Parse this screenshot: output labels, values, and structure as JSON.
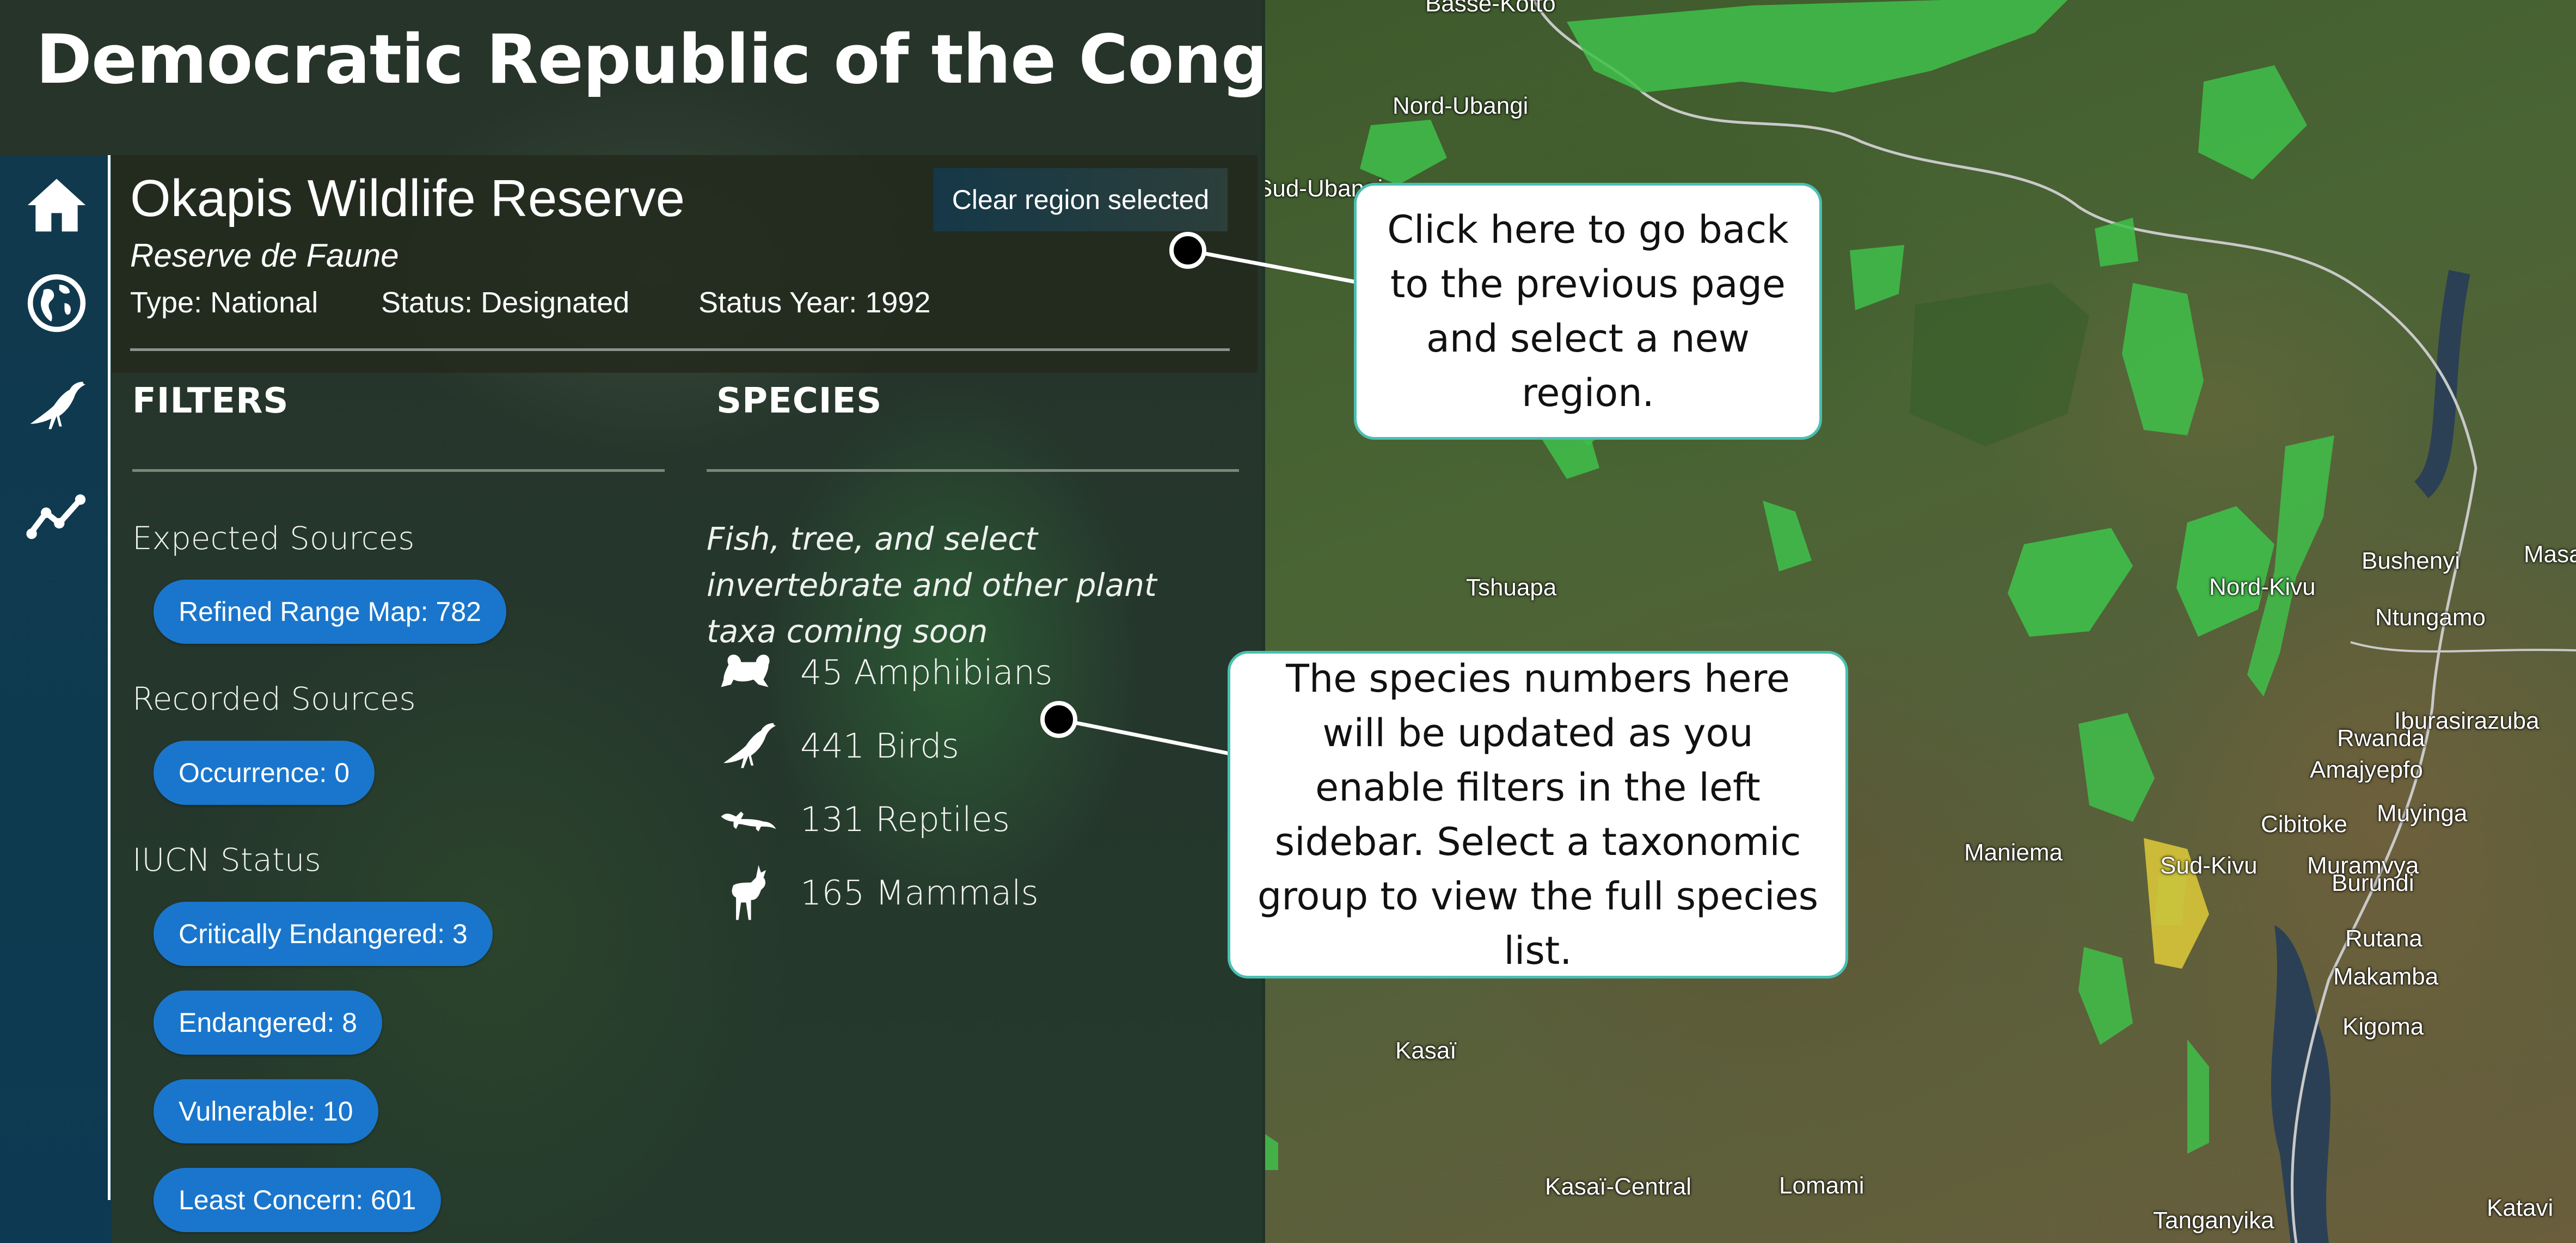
{
  "country_title": "Democratic Republic of the Congo",
  "nav": [
    {
      "name": "home-icon"
    },
    {
      "name": "globe-icon"
    },
    {
      "name": "bird-icon"
    },
    {
      "name": "trend-chart-icon"
    }
  ],
  "region": {
    "name": "Okapis Wildlife Reserve",
    "designation": "Reserve de Faune",
    "type": "Type: National",
    "status": "Status: Designated",
    "status_year": "Status Year: 1992",
    "clear_button": "Clear region selected"
  },
  "filters": {
    "title": "FILTERS",
    "expected_label": "Expected Sources",
    "expected": [
      "Refined Range Map: 782"
    ],
    "recorded_label": "Recorded Sources",
    "recorded": [
      "Occurrence: 0"
    ],
    "iucn_label": "IUCN Status",
    "iucn": [
      "Critically Endangered: 3",
      "Endangered: 8",
      "Vulnerable: 10",
      "Least Concern: 601"
    ]
  },
  "species": {
    "title": "SPECIES",
    "note": "Fish, tree, and select invertebrate and other plant taxa coming soon",
    "groups": [
      {
        "label": "45 Amphibians",
        "icon": "frog-icon"
      },
      {
        "label": "441 Birds",
        "icon": "bird-icon"
      },
      {
        "label": "131 Reptiles",
        "icon": "lizard-icon"
      },
      {
        "label": "165 Mammals",
        "icon": "antelope-icon"
      }
    ]
  },
  "callouts": {
    "back": "Click here to go back to the previous page and select a new region.",
    "species": "The species numbers here will be updated as you enable filters in the left sidebar. Select a taxonomic group to view the full species list."
  },
  "map_labels": [
    "Basse-Kotto",
    "Nord-Ubangi",
    "Sud-Ubangi",
    "Tshuapa",
    "Nord-Kivu",
    "Bushenyi",
    "Masaka",
    "Ntungamo",
    "Maniema",
    "Sud-Kivu",
    "Rwanda",
    "Amajyepfo",
    "Iburasirazuba",
    "Cibitoke",
    "Muyinga",
    "Muramvya",
    "Burundi",
    "Rutana",
    "Makamba",
    "Kigoma",
    "Kasaï",
    "Kasaï-Central",
    "Lomami",
    "Tanganyika",
    "Katavi"
  ],
  "colors": {
    "pill": "#1a76cc",
    "icon_rail": "#10394d",
    "callout_border": "#4bbfb4",
    "protected_area": "#3fbf4a",
    "highlight_area": "#d8c43a"
  }
}
